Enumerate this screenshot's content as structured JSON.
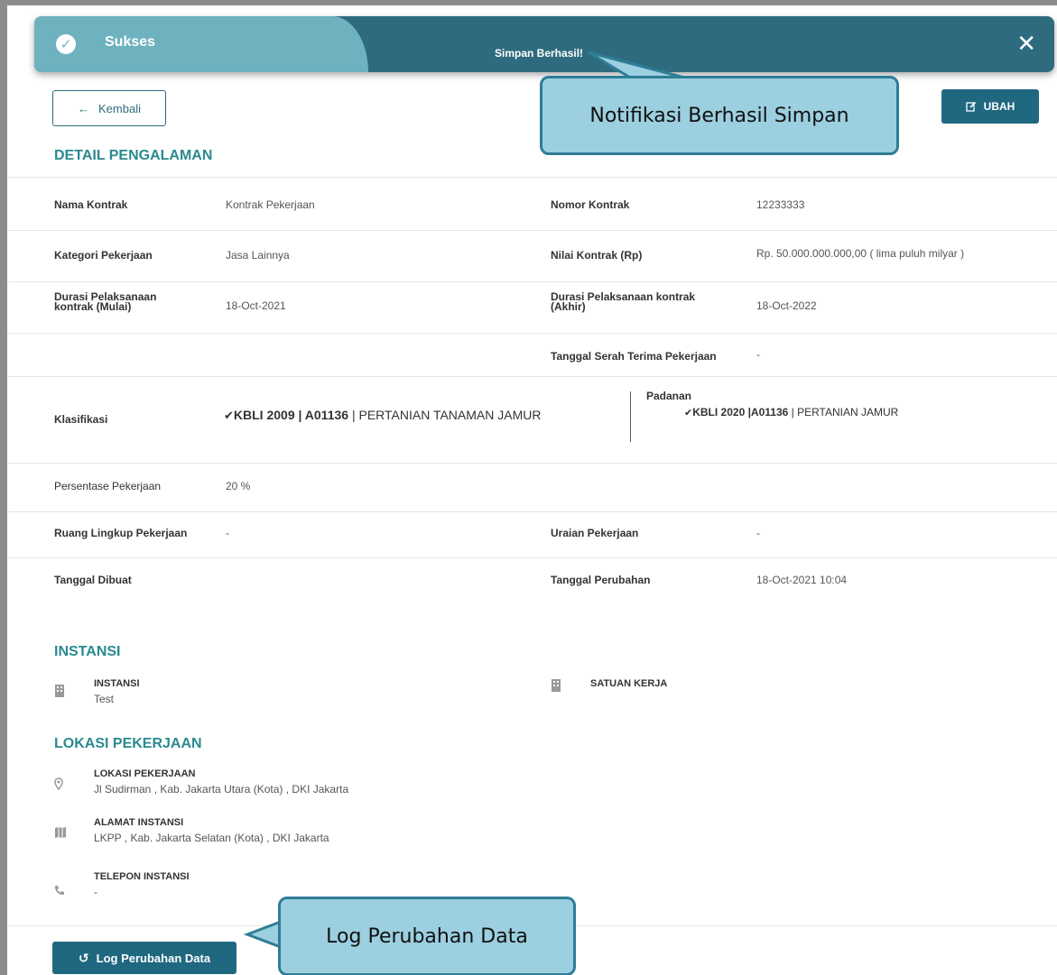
{
  "toast": {
    "title": "Sukses",
    "message": "Simpan Berhasil!",
    "close": "✕"
  },
  "callouts": {
    "notif": "Notifikasi Berhasil Simpan",
    "log": "Log Perubahan Data"
  },
  "header": {
    "back_label": "Kembali",
    "edit_label": "UBAH"
  },
  "detail": {
    "title": "DETAIL PENGALAMAN",
    "nama_kontrak_label": "Nama Kontrak",
    "nama_kontrak": "Kontrak Pekerjaan",
    "nomor_kontrak_label": "Nomor Kontrak",
    "nomor_kontrak": "12233333",
    "kategori_label": "Kategori Pekerjaan",
    "kategori": "Jasa Lainnya",
    "nilai_label": "Nilai Kontrak (Rp)",
    "nilai": "Rp. 50.000.000.000,00 ( lima puluh milyar )",
    "durasi_mulai_label_1": "Durasi Pelaksanaan",
    "durasi_mulai_label_2": "kontrak (Mulai)",
    "durasi_mulai": "18-Oct-2021",
    "durasi_akhir_label_1": "Durasi Pelaksanaan kontrak",
    "durasi_akhir_label_2": "(Akhir)",
    "durasi_akhir": "18-Oct-2022",
    "serah_terima_label": "Tanggal Serah Terima Pekerjaan",
    "serah_terima": "-",
    "klasifikasi_label": "Klasifikasi",
    "klasifikasi_code": "KBLI 2009 | A01136",
    "klasifikasi_name": " | PERTANIAN TANAMAN JAMUR",
    "padanan_label": "Padanan",
    "padanan_code": "KBLI 2020 |A01136",
    "padanan_name": " | PERTANIAN JAMUR",
    "persentase_label": "Persentase Pekerjaan",
    "persentase": "20 %",
    "ruang_lingkup_label": "Ruang Lingkup Pekerjaan",
    "ruang_lingkup": "-",
    "uraian_label": "Uraian Pekerjaan",
    "uraian": "-",
    "dibuat_label": "Tanggal Dibuat",
    "perubahan_label": "Tanggal Perubahan",
    "perubahan": "18-Oct-2021 10:04"
  },
  "instansi": {
    "title": "INSTANSI",
    "instansi_label": "INSTANSI",
    "instansi_value": "Test",
    "satuan_label": "SATUAN KERJA"
  },
  "lokasi": {
    "title": "LOKASI PEKERJAAN",
    "lokasi_label": "LOKASI PEKERJAAN",
    "lokasi_value": "Jl Sudirman , Kab. Jakarta Utara (Kota) , DKI Jakarta",
    "alamat_label": "ALAMAT INSTANSI",
    "alamat_value": "LKPP , Kab. Jakarta Selatan (Kota) , DKI Jakarta",
    "telepon_label": "TELEPON INSTANSI",
    "telepon_value": "-"
  },
  "footer": {
    "log_label": "Log Perubahan Data"
  },
  "colors": {
    "accent": "#1f6880",
    "section_title": "#2a8a8f",
    "toast_light": "#6eb2c0",
    "toast_dark": "#2f6b7e",
    "callout_fill": "#9ccfe0"
  }
}
